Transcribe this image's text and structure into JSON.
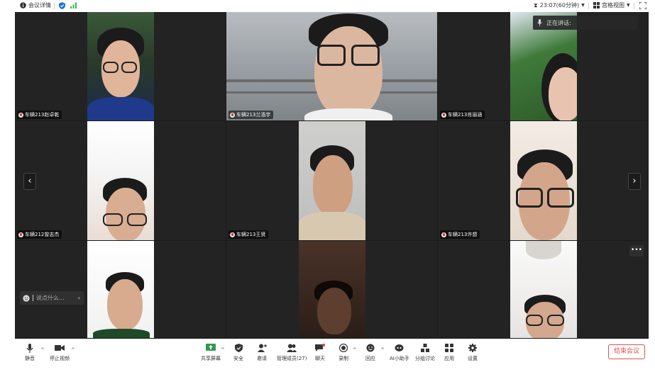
{
  "topbar": {
    "meeting_info": "会议详情",
    "timer": "23:07(60分钟)",
    "view_mode": "宫格视图"
  },
  "speaking_indicator": "正在讲话:",
  "participants": [
    {
      "name": "车辆213赵卓乾"
    },
    {
      "name": "车辆213兰浩宇"
    },
    {
      "name": "车辆213肖丽涵"
    },
    {
      "name": "车辆212曾志杰"
    },
    {
      "name": "车辆213王贤"
    },
    {
      "name": "车辆213许想"
    }
  ],
  "chat": {
    "placeholder": "说点什么..."
  },
  "toolbar": {
    "mute": "静音",
    "stop_video": "停止视频",
    "share_screen": "共享屏幕",
    "security": "安全",
    "invite": "邀请",
    "manage_members": "管理成员(27)",
    "chat": "聊天",
    "record": "录制",
    "reactions": "回应",
    "ai_assistant": "AI小助手",
    "breakout": "分组讨论",
    "apps": "应用",
    "settings": "设置",
    "end_meeting": "结束会议"
  },
  "icons": [
    "info-icon",
    "shield-icon",
    "signal-icon",
    "hourglass-icon",
    "grid-view-icon",
    "fullscreen-icon",
    "mic-icon",
    "camera-icon",
    "share-screen-icon",
    "person-add-icon",
    "members-icon",
    "chat-icon",
    "record-icon",
    "reaction-icon",
    "ai-icon",
    "breakout-icon",
    "apps-icon",
    "gear-icon",
    "chevron-left-icon",
    "chevron-right-icon",
    "more-icon",
    "emoji-icon"
  ],
  "colors": {
    "accent": "#1a73e8",
    "end_meeting": "#e05050",
    "signal": "#2db84d"
  }
}
